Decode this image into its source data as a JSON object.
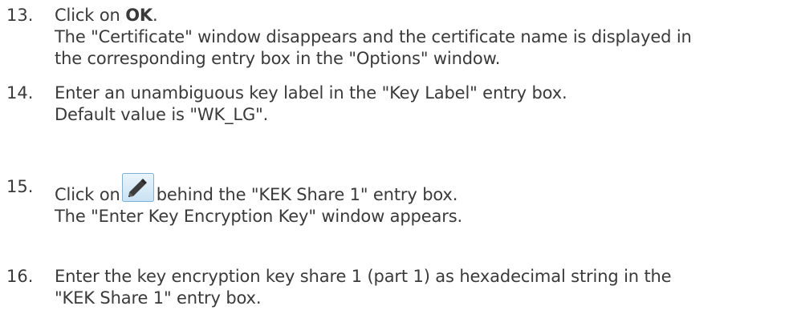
{
  "steps": [
    {
      "number": "13.",
      "prefix": "Click on ",
      "bold": "OK",
      "suffix": ".",
      "detail_lines": [
        "The \"Certificate\" window disappears and the certificate name is displayed in",
        "the corresponding entry box in the \"Options\" window."
      ]
    },
    {
      "number": "14.",
      "lines": [
        "Enter an unambiguous key label in the \"Key Label\" entry box.",
        "Default value is \"WK_LG\"."
      ]
    },
    {
      "number": "15.",
      "prefix": "Click on",
      "icon": "pencil-edit-icon",
      "suffix": "behind the \"KEK Share 1\" entry box.",
      "detail_lines": [
        "The \"Enter Key Encryption Key\" window appears."
      ]
    },
    {
      "number": "16.",
      "lines": [
        "Enter the key encryption key share 1 (part 1) as hexadecimal string in the",
        "\"KEK Share 1\" entry box."
      ]
    }
  ],
  "colors": {
    "text": "#3a3a3a",
    "icon_bg": "#d9ecf8",
    "icon_border": "#7fb2d9"
  }
}
